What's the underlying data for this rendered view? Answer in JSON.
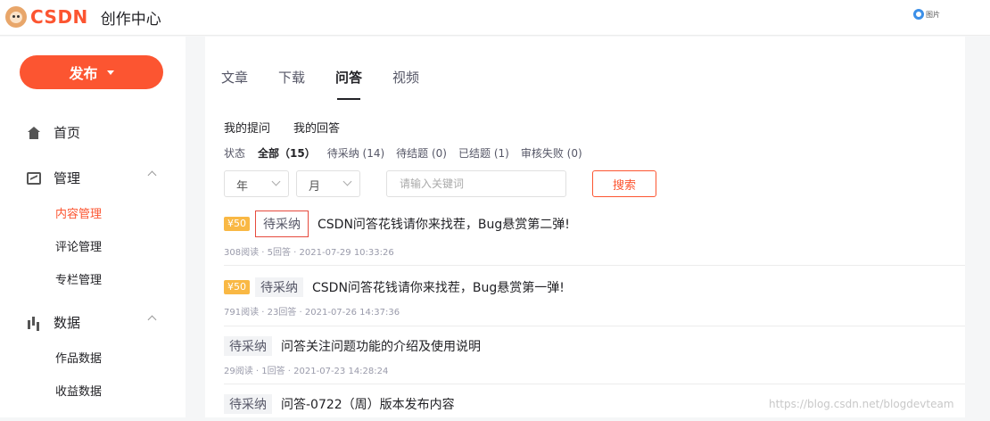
{
  "header": {
    "logo_text": "CSDN",
    "app_title": "创作中心",
    "right_text": "图片"
  },
  "sidebar": {
    "publish_label": "发布",
    "items": [
      {
        "label": "首页",
        "icon": "home-icon"
      },
      {
        "label": "管理",
        "icon": "manage-icon"
      },
      {
        "label": "数据",
        "icon": "data-icon"
      }
    ],
    "manage_sub": [
      "内容管理",
      "评论管理",
      "专栏管理"
    ],
    "data_sub": [
      "作品数据",
      "收益数据"
    ]
  },
  "main": {
    "tabs": [
      "文章",
      "下载",
      "问答",
      "视频"
    ],
    "active_tab": "问答",
    "subtabs": [
      "我的提问",
      "我的回答"
    ],
    "filter_label": "状态",
    "filters": [
      "全部（15）",
      "待采纳 (14)",
      "待结题 (0)",
      "已结题 (1)",
      "审核失败 (0)"
    ],
    "year_select": "年",
    "month_select": "月",
    "search_placeholder": "请输入关键词",
    "search_button": "搜索",
    "questions": [
      {
        "bounty": "¥50",
        "status": "待采纳",
        "title": "CSDN问答花钱请你来找茬，Bug悬赏第二弹!",
        "meta": "308阅读 · 5回答 · 2021-07-29 10:33:26"
      },
      {
        "bounty": "¥50",
        "status": "待采纳",
        "title": "CSDN问答花钱请你来找茬，Bug悬赏第一弹!",
        "meta": "791阅读 · 23回答 · 2021-07-26 14:37:36"
      },
      {
        "bounty": "",
        "status": "待采纳",
        "title": "问答关注问题功能的介绍及使用说明",
        "meta": "29阅读 · 1回答 · 2021-07-23 14:28:24"
      },
      {
        "bounty": "",
        "status": "待采纳",
        "title": "问答-0722（周）版本发布内容",
        "meta": ""
      }
    ]
  },
  "watermark": "https://blog.csdn.net/blogdevteam",
  "colors": {
    "brand": "#fc5531",
    "bounty": "#f9b844"
  }
}
